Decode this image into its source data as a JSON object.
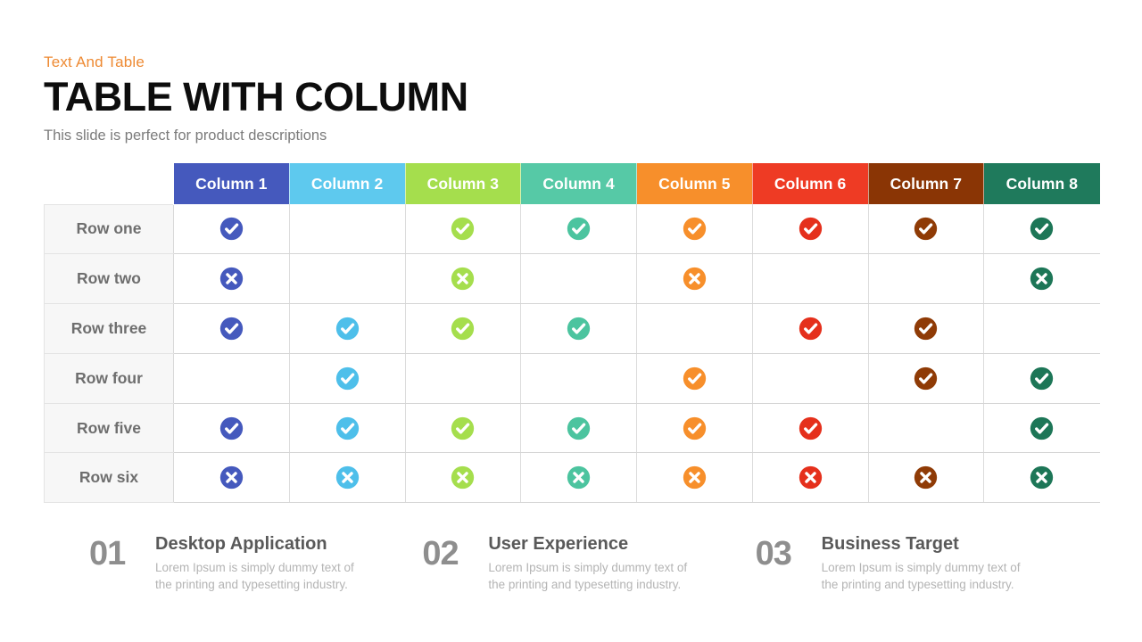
{
  "slide": {
    "eyebrow": "Text And Table",
    "title": "TABLE WITH COLUMN",
    "subtitle": "This slide is perfect for product descriptions",
    "eyebrow_color": "#ee8a33",
    "title_color": "#0d0d0d",
    "subtitle_color": "#7b7b7b",
    "background": "#ffffff"
  },
  "table": {
    "corner_label": "",
    "columns": [
      {
        "label": "Column 1",
        "color": "#4559bd",
        "icon_color": "#4559bd"
      },
      {
        "label": "Column 2",
        "color": "#5ec9ee",
        "icon_color": "#4ebfea"
      },
      {
        "label": "Column 3",
        "color": "#a5de4d",
        "icon_color": "#a5de4d"
      },
      {
        "label": "Column 4",
        "color": "#56c9a6",
        "icon_color": "#4cc49f"
      },
      {
        "label": "Column 5",
        "color": "#f78f2b",
        "icon_color": "#f78f2b"
      },
      {
        "label": "Column 6",
        "color": "#ee3b24",
        "icon_color": "#e5301c"
      },
      {
        "label": "Column 7",
        "color": "#8a3505",
        "icon_color": "#8f3b06"
      },
      {
        "label": "Column 8",
        "color": "#1f7a5c",
        "icon_color": "#1d7657"
      }
    ],
    "rows": [
      {
        "label": "Row one",
        "cells": [
          "check",
          "none",
          "check",
          "check",
          "check",
          "check",
          "check",
          "check"
        ]
      },
      {
        "label": "Row two",
        "cells": [
          "cross",
          "none",
          "cross",
          "none",
          "cross",
          "none",
          "none",
          "cross"
        ]
      },
      {
        "label": "Row three",
        "cells": [
          "check",
          "check",
          "check",
          "check",
          "none",
          "check",
          "check",
          "none"
        ]
      },
      {
        "label": "Row four",
        "cells": [
          "none",
          "check",
          "none",
          "none",
          "check",
          "none",
          "check",
          "check"
        ]
      },
      {
        "label": "Row five",
        "cells": [
          "check",
          "check",
          "check",
          "check",
          "check",
          "check",
          "none",
          "check"
        ]
      },
      {
        "label": "Row six",
        "cells": [
          "cross",
          "cross",
          "cross",
          "cross",
          "cross",
          "cross",
          "cross",
          "cross"
        ]
      }
    ],
    "row_label_bg": "#f7f7f7",
    "row_label_color": "#6e6e6e",
    "cell_bg": "#ffffff",
    "grid_color": "#dcdcdc",
    "icon_names": {
      "check": "check-circle-icon",
      "cross": "cross-circle-icon",
      "none": "empty-cell"
    }
  },
  "features": [
    {
      "number": "01",
      "heading": "Desktop Application",
      "body": "Lorem Ipsum is simply dummy text of the printing and typesetting industry."
    },
    {
      "number": "02",
      "heading": "User Experience",
      "body": "Lorem Ipsum is simply dummy text of the printing and typesetting industry."
    },
    {
      "number": "03",
      "heading": "Business Target",
      "body": "Lorem Ipsum is simply dummy text of the printing and typesetting industry."
    }
  ],
  "feature_styles": {
    "number_color": "#8e8e8e",
    "heading_color": "#595959",
    "body_color": "#b4b4b4"
  }
}
